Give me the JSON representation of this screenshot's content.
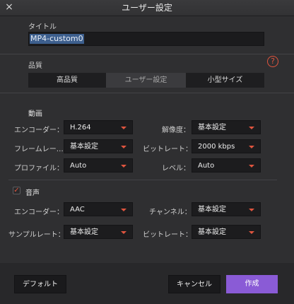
{
  "window": {
    "title": "ユーザー設定"
  },
  "title_section": {
    "label": "タイトル",
    "value": "MP4-custom0"
  },
  "quality": {
    "label": "品質",
    "help": "?",
    "options": [
      "高品質",
      "ユーザー設定",
      "小型サイズ"
    ],
    "selected": "ユーザー設定"
  },
  "video": {
    "label": "動画",
    "encoder": {
      "label": "エンコーダー：",
      "value": "H.264"
    },
    "resolution": {
      "label": "解像度：",
      "value": "基本設定"
    },
    "framerate": {
      "label": "フレームレー…",
      "value": "基本設定"
    },
    "bitrate": {
      "label": "ビットレート：",
      "value": "2000 kbps"
    },
    "profile": {
      "label": "プロファイル：",
      "value": "Auto"
    },
    "level": {
      "label": "レベル：",
      "value": "Auto"
    }
  },
  "audio": {
    "label": "音声",
    "enabled": true,
    "check": "✓",
    "encoder": {
      "label": "エンコーダー：",
      "value": "AAC"
    },
    "channel": {
      "label": "チャンネル：",
      "value": "基本設定"
    },
    "samplerate": {
      "label": "サンプルレート：",
      "value": "基本設定"
    },
    "bitrate": {
      "label": "ビットレート：",
      "value": "基本設定"
    }
  },
  "footer": {
    "default_label": "デフォルト",
    "cancel_label": "キャンセル",
    "create_label": "作成"
  },
  "colors": {
    "accent": "#e0553f",
    "primary_button": "#8a5bd6",
    "selection": "#3d5f8e"
  }
}
